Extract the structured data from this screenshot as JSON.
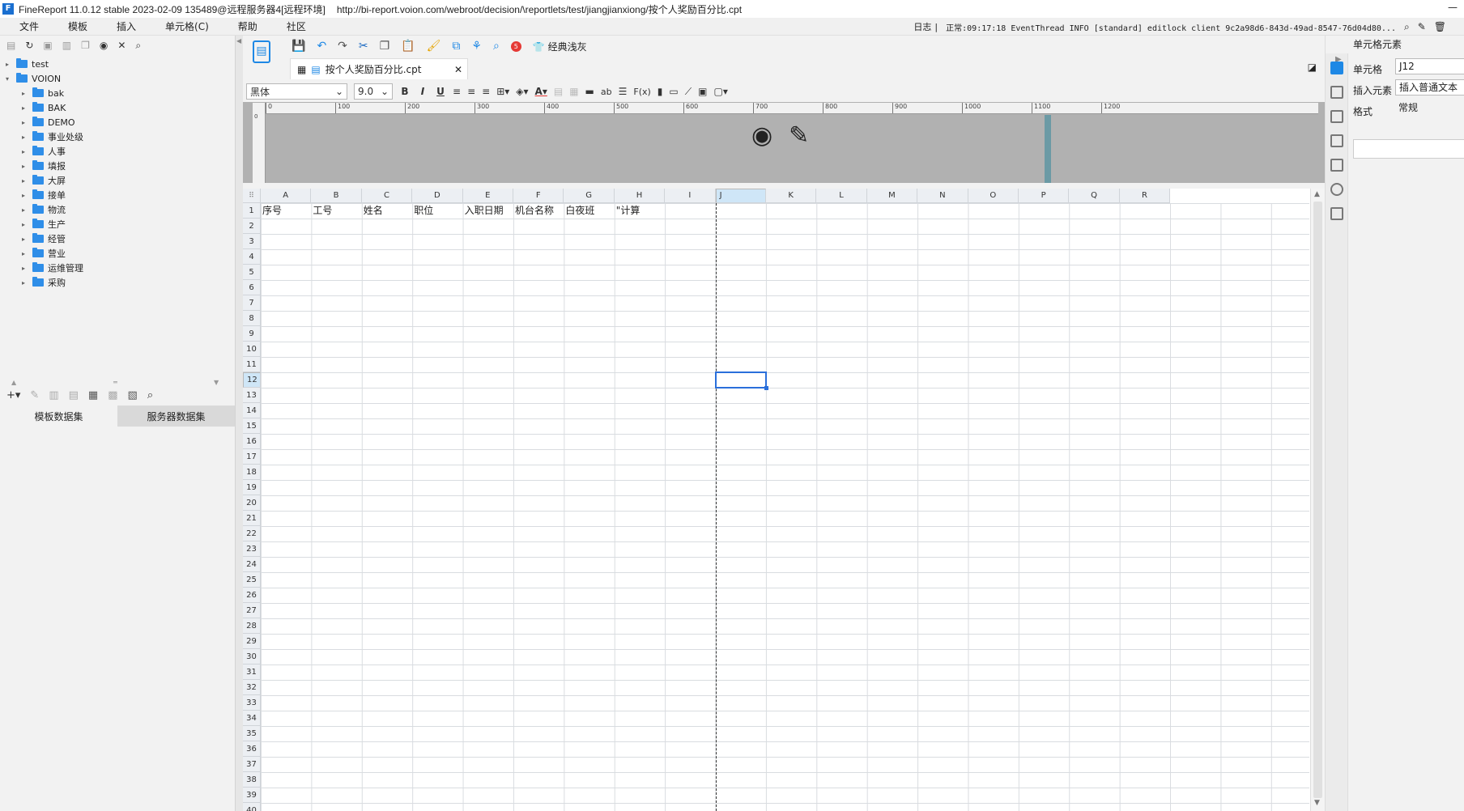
{
  "titlebar": {
    "title": "FineReport 11.0.12 stable 2023-02-09 135489@远程服务器4[远程环境]",
    "url": "http://bi-report.voion.com/webroot/decision/\\reportlets/test/jiangjianxiong/按个人奖励百分比.cpt"
  },
  "menu": [
    "文件",
    "模板",
    "插入",
    "单元格(C)",
    "帮助",
    "社区"
  ],
  "log": {
    "label": "日志",
    "status": "正常:09:17:18 EventThread INFO [standard] editlock client 9c2a98d6-843d-49ad-8547-76d04d80..."
  },
  "tree": {
    "items": [
      {
        "label": "test",
        "arrow": "▸",
        "level": 0
      },
      {
        "label": "VOION",
        "arrow": "▾",
        "level": 0
      },
      {
        "label": "bak",
        "arrow": "▸",
        "level": 1
      },
      {
        "label": "BAK",
        "arrow": "▸",
        "level": 1
      },
      {
        "label": "DEMO",
        "arrow": "▸",
        "level": 1
      },
      {
        "label": "事业处级",
        "arrow": "▸",
        "level": 1
      },
      {
        "label": "人事",
        "arrow": "▸",
        "level": 1
      },
      {
        "label": "填报",
        "arrow": "▸",
        "level": 1
      },
      {
        "label": "大屏",
        "arrow": "▸",
        "level": 1
      },
      {
        "label": "接单",
        "arrow": "▸",
        "level": 1
      },
      {
        "label": "物流",
        "arrow": "▸",
        "level": 1
      },
      {
        "label": "生产",
        "arrow": "▸",
        "level": 1
      },
      {
        "label": "经管",
        "arrow": "▸",
        "level": 1
      },
      {
        "label": "营业",
        "arrow": "▸",
        "level": 1
      },
      {
        "label": "运维管理",
        "arrow": "▸",
        "level": 1
      },
      {
        "label": "采购",
        "arrow": "▸",
        "level": 1
      }
    ]
  },
  "dataset_tabs": {
    "template": "模板数据集",
    "server": "服务器数据集"
  },
  "toolbar": {
    "classic_label": "经典浅灰",
    "badge": "5"
  },
  "file_tab": {
    "name": "按个人奖励百分比.cpt"
  },
  "format": {
    "font": "黑体",
    "size": "9.0",
    "bold": "B",
    "italic": "I",
    "underline": "U",
    "wrap_label": "ab",
    "formula_label": "F(x)"
  },
  "ruler": {
    "ticks": [
      "0",
      "100",
      "200",
      "300",
      "400",
      "500",
      "600",
      "700",
      "800",
      "900",
      "1000",
      "1100",
      "1200"
    ],
    "v0": "0"
  },
  "sheet": {
    "columns": [
      "A",
      "B",
      "C",
      "D",
      "E",
      "F",
      "G",
      "H",
      "I",
      "J",
      "K",
      "L",
      "M",
      "N",
      "O",
      "P",
      "Q",
      "R"
    ],
    "selected_col": "J",
    "selected_row": "12",
    "header_row": [
      "序号",
      "工号",
      "姓名",
      "职位",
      "入职日期",
      "机台名称",
      "白夜班",
      "\"计算"
    ],
    "row_count": 40
  },
  "right_panel": {
    "title": "单元格元素",
    "cell_label": "单元格",
    "cell_value": "J12",
    "insert_label": "插入元素",
    "insert_value": "插入普通文本",
    "format_label": "格式",
    "format_value": "常规"
  },
  "colors": {
    "accent": "#1e88e5",
    "selection": "#cfe6f7",
    "folder": "#2f8ee8"
  }
}
